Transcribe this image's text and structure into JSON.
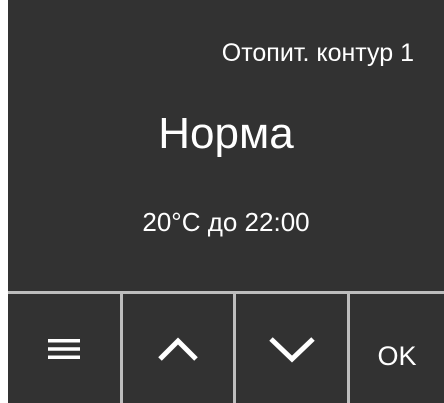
{
  "display": {
    "circuit_title": "Отопит. контур 1",
    "mode": "Норма",
    "setpoint": "20°C до 22:00"
  },
  "buttons": {
    "menu_icon": "hamburger-menu-icon",
    "up_icon": "chevron-up-icon",
    "down_icon": "chevron-down-icon",
    "ok_label": "OK"
  },
  "colors": {
    "screen_background": "#323232",
    "text": "#ffffff",
    "divider": "#bdbdbd"
  }
}
